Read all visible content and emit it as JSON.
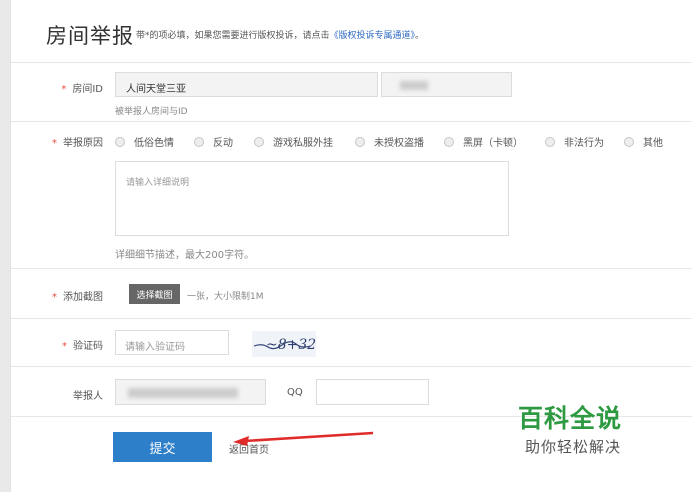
{
  "header": {
    "title": "房间举报",
    "note": "带*的项必填，如果您需要进行版权投诉，请点击",
    "link": "《版权投诉专属通道》",
    "note_end": "。"
  },
  "room": {
    "label": "房间ID",
    "value": "人间天堂三亚",
    "hint": "被举报人房间与ID"
  },
  "reason": {
    "label": "举报原因",
    "options": [
      "低俗色情",
      "反动",
      "游戏私服外挂",
      "未授权盗播",
      "黑屏（卡顿）",
      "非法行为",
      "其他"
    ],
    "placeholder": "请输入详细说明",
    "hint": "详细细节描述，最大200字符。"
  },
  "screenshot": {
    "label": "添加截图",
    "button": "选择截图",
    "hint": "一张，大小限制1M"
  },
  "captcha": {
    "label": "验证码",
    "placeholder": "请输入验证码",
    "image_text": "~8+32"
  },
  "reporter": {
    "label": "举报人",
    "qq_label": "QQ"
  },
  "actions": {
    "submit": "提交",
    "back": "返回首页"
  },
  "watermark": {
    "line1": "百科全说",
    "line2": "助你轻松解决"
  },
  "colors": {
    "accent": "#2d7fc9",
    "required": "#e84c3d",
    "watermark": "#2d9a42"
  }
}
